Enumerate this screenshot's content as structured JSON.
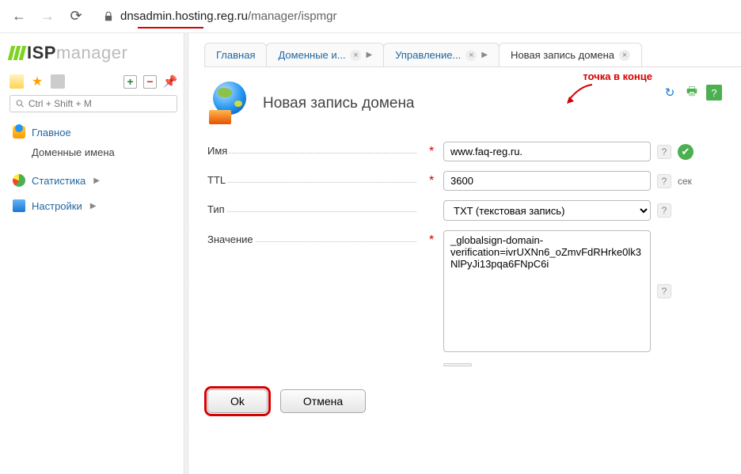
{
  "browser": {
    "url_dark": "dnsadmin.hosting.reg.ru",
    "url_light": "/manager/ispmgr"
  },
  "logo": {
    "strong": "ISP",
    "light": "manager"
  },
  "search": {
    "placeholder": "Ctrl + Shift + M"
  },
  "sidebar": {
    "items": [
      {
        "label": "Главное",
        "icon": "globe"
      },
      {
        "label": "Доменные имена",
        "sub": true
      },
      {
        "label": "Статистика",
        "icon": "pie"
      },
      {
        "label": "Настройки",
        "icon": "mon"
      }
    ]
  },
  "tabs": [
    {
      "label": "Главная",
      "closable": false
    },
    {
      "label": "Доменные и...",
      "closable": true
    },
    {
      "label": "Управление...",
      "closable": true
    },
    {
      "label": "Новая запись домена",
      "closable": true,
      "active": true
    }
  ],
  "page": {
    "title": "Новая запись домена"
  },
  "annotation": "точка в конце",
  "form": {
    "name_label": "Имя",
    "name_value": "www.faq-reg.ru.",
    "ttl_label": "TTL",
    "ttl_value": "3600",
    "ttl_suffix": "сек",
    "type_label": "Тип",
    "type_value": "TXT (текстовая запись)",
    "value_label": "Значение",
    "value_text": "_globalsign-domain-verification=ivrUXNn6_oZmvFdRHrke0lk3NlPyJi13pqa6FNpC6i"
  },
  "buttons": {
    "ok": "Ok",
    "cancel": "Отмена"
  }
}
